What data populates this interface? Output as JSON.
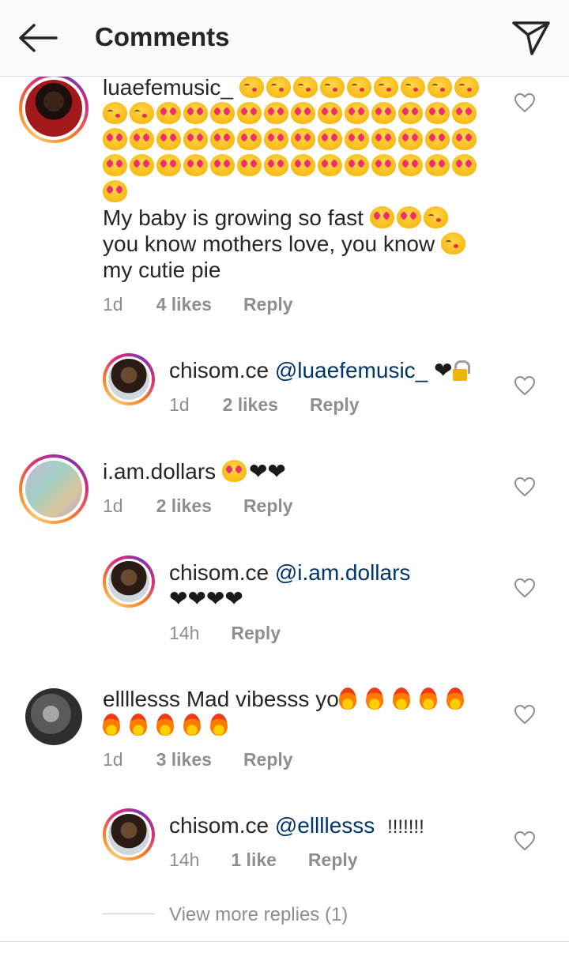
{
  "header": {
    "title": "Comments",
    "back_icon": "arrow-left-icon",
    "send_icon": "paper-plane-icon"
  },
  "comments": [
    {
      "username": "luaefemusic_",
      "emoji_line": "😖😖😖😖😖😖😖😖😖😖😖😍😍😍😍😍😍😍😍😍😍😍😍😍😍😍😍😍😍😍😍😍😍😍😍😍😍😍😍😍😍😍😍😍😍😍😍😍😍😍😍😍😍😍😍😍😍",
      "text_part1": "My baby is growing so fast",
      "text_part2": "you know mothers love, you know",
      "text_part3": "my cutie pie",
      "time": "1d",
      "likes": "4 likes",
      "reply": "Reply"
    },
    {
      "username": "chisom.ce",
      "mention": "@luaefemusic_",
      "text": "❤🔒",
      "time": "1d",
      "likes": "2 likes",
      "reply": "Reply"
    },
    {
      "username": "i.am.dollars",
      "text": "😍❤❤",
      "time": "1d",
      "likes": "2 likes",
      "reply": "Reply"
    },
    {
      "username": "chisom.ce",
      "mention": "@i.am.dollars",
      "text": "❤❤❤❤",
      "time": "14h",
      "reply": "Reply"
    },
    {
      "username": "ellllesss",
      "text": "Mad vibesss yo",
      "emoji_tail": "🔥🔥🔥🔥🔥🔥🔥🔥🔥🔥",
      "time": "1d",
      "likes": "3 likes",
      "reply": "Reply"
    },
    {
      "username": "chisom.ce",
      "mention": "@ellllesss",
      "text": "!!!!!!!",
      "time": "14h",
      "likes": "1 like",
      "reply": "Reply"
    }
  ],
  "view_more_replies": "View more replies (1)",
  "colors": {
    "text": "#262626",
    "secondary": "#8e8e8e",
    "mention": "#003569",
    "header_bg": "#fafafa"
  }
}
